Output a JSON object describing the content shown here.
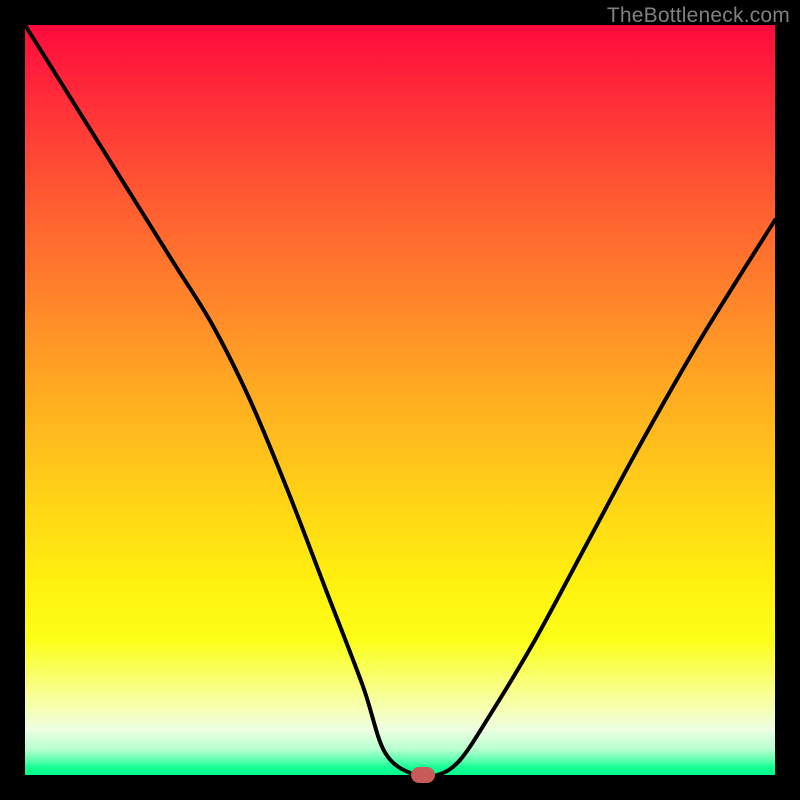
{
  "watermark": "TheBottleneck.com",
  "chart_data": {
    "type": "line",
    "title": "",
    "xlabel": "",
    "ylabel": "",
    "xlim": [
      0,
      100
    ],
    "ylim": [
      0,
      100
    ],
    "grid": false,
    "legend": false,
    "series": [
      {
        "name": "bottleneck-curve",
        "x": [
          0,
          5,
          10,
          15,
          20,
          25,
          30,
          35,
          40,
          45,
          48,
          52,
          55,
          58,
          62,
          68,
          75,
          82,
          90,
          100
        ],
        "y": [
          100,
          92,
          84,
          76,
          68,
          60,
          50,
          38,
          25,
          12,
          3,
          0,
          0,
          2,
          8,
          18,
          31,
          44,
          58,
          74
        ]
      }
    ],
    "marker": {
      "x": 53,
      "y": 0,
      "color": "#c85a5a"
    },
    "gradient_colors": {
      "top": "#ff0a3c",
      "upper_mid": "#ff8f28",
      "mid": "#fff00f",
      "lower": "#14ff94",
      "bottom": "#00ff8c"
    }
  }
}
